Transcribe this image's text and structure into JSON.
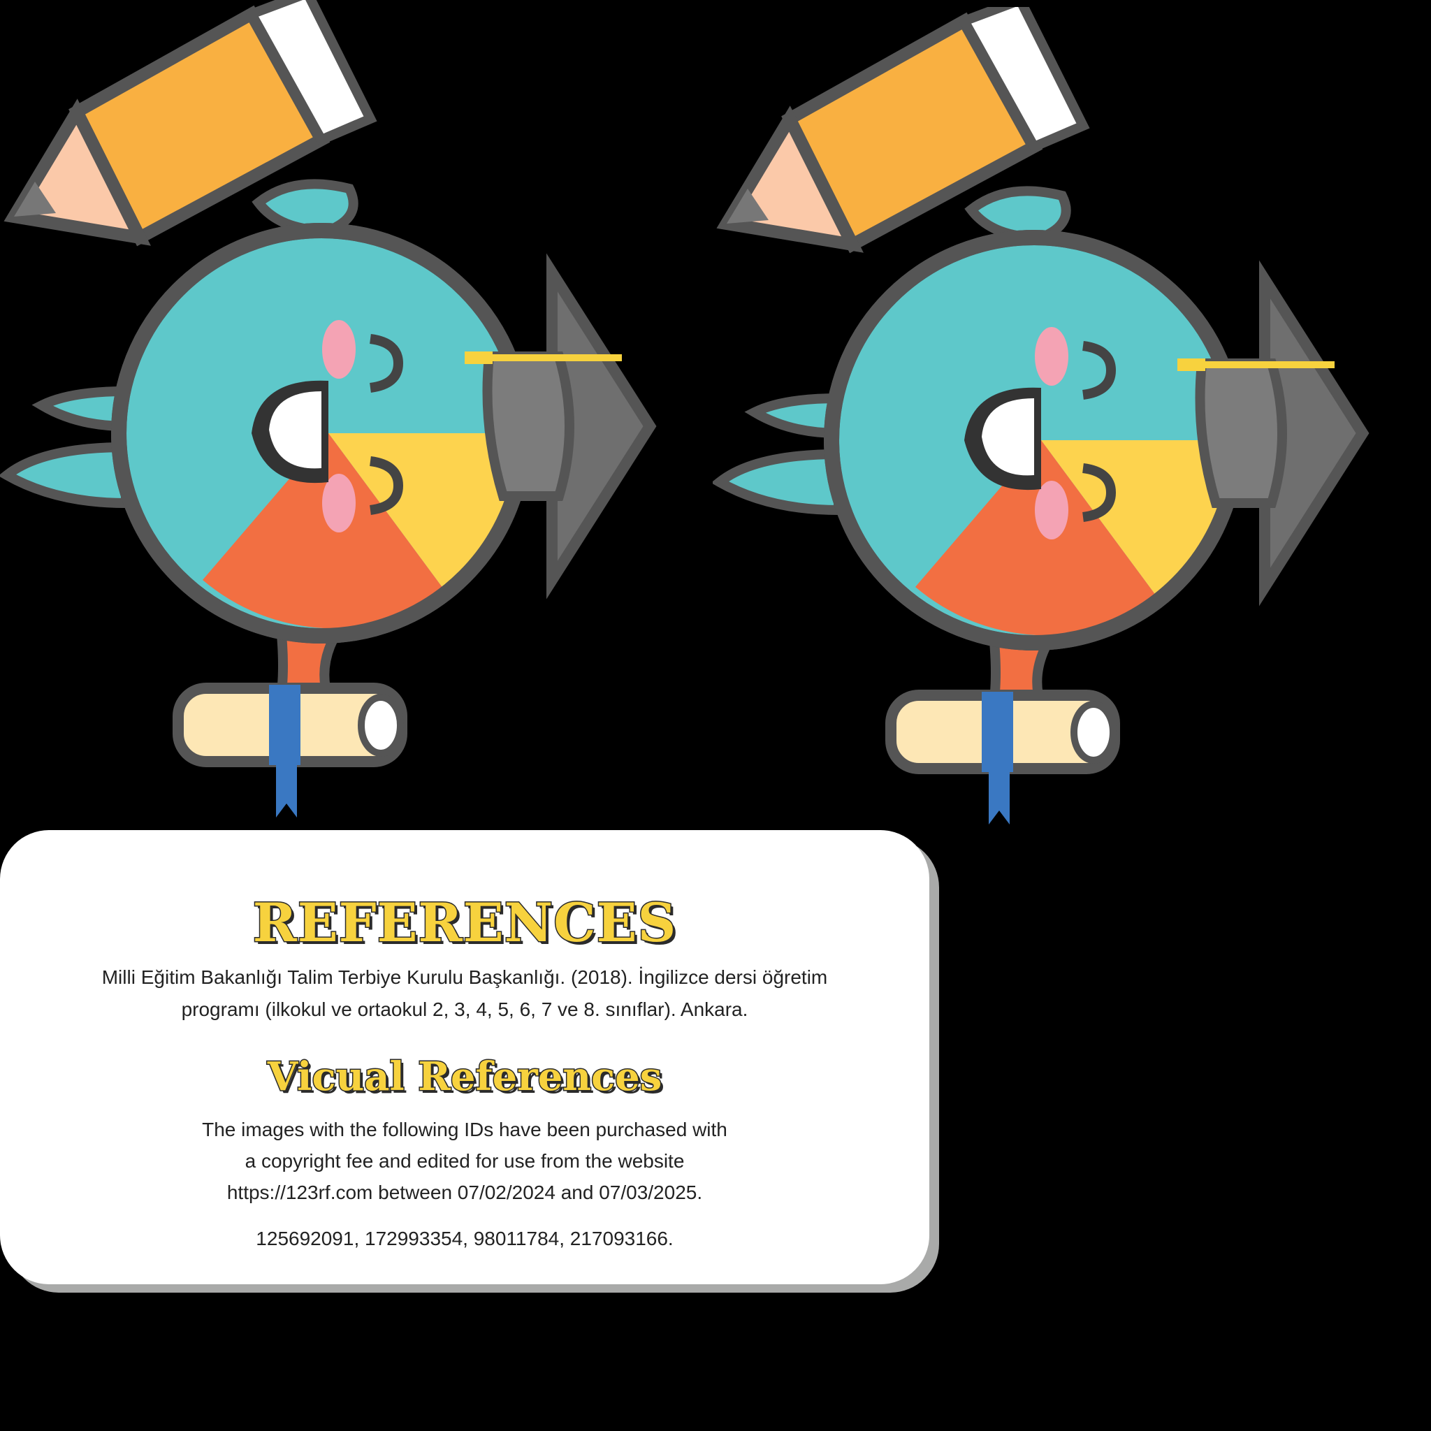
{
  "colors": {
    "background": "#000000",
    "heading_fill": "#f7d23e",
    "heading_outline": "#2b2b2b",
    "card": "#ffffff",
    "card_shadow": "#a9aaa9",
    "teal": "#5ec8ca",
    "yellow": "#fdd34e",
    "orange": "#f26f42",
    "outline": "#555555"
  },
  "icons": [
    "pencil-icon",
    "graduation-cap-icon",
    "diploma-scroll-icon",
    "pie-chart-mascot-icon"
  ],
  "references": {
    "title": "REFERENCES",
    "entry_line1": "Milli Eğitim Bakanlığı Talim Terbiye Kurulu Başkanlığı. (2018). İngilizce dersi öğretim",
    "entry_line2": "programı (ilkokul ve ortaokul 2, 3, 4, 5, 6, 7 ve 8. sınıflar). Ankara."
  },
  "visual_references": {
    "title": "Vicual References",
    "line1": "The images with the following IDs have been purchased with",
    "line2": "a copyright fee and edited for use from the website",
    "line3": "https://123rf.com between 07/02/2024 and 07/03/2025.",
    "ids": "125692091, 172993354, 98011784, 217093166."
  }
}
